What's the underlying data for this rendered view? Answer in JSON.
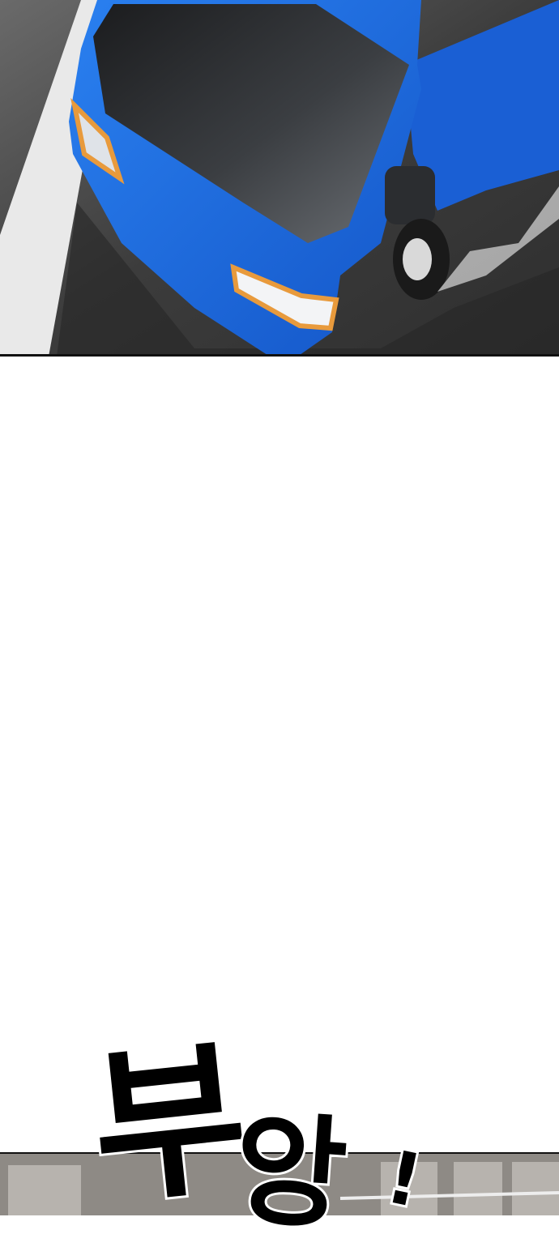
{
  "top_panel": {
    "subject": "blue-truck",
    "colors": {
      "truck_body": "#1e6fe6",
      "truck_shadow": "#0d3f9c",
      "windshield": "#3a3d40",
      "road": "#3b3b3b",
      "lane_marking": "#e9e9e9",
      "headlight_amber": "#e89a3c"
    }
  },
  "gutter": {
    "color": "#ffffff"
  },
  "bottom_panel": {
    "colors": {
      "wall": "#8e8a85",
      "window": "#b7b3ae"
    }
  },
  "sound_effect": {
    "parts": [
      "부",
      "앙",
      "!"
    ]
  }
}
